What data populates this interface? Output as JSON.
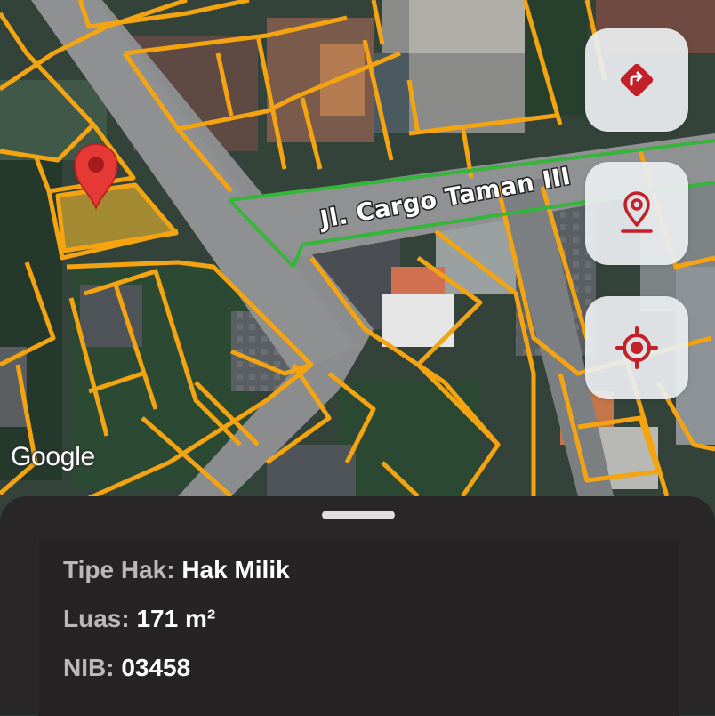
{
  "map": {
    "street_name": "Jl. Cargo Taman III",
    "attribution": "Google",
    "colors": {
      "parcel_outline": "#f4a410",
      "selected_parcel_fill": "#c9a030",
      "street_highlight": "#35b53a",
      "marker": "#e53935"
    }
  },
  "controls": {
    "directions_icon": "directions-icon",
    "pin_icon": "location-pin-icon",
    "locate_icon": "my-location-icon",
    "accent": "#c4202a"
  },
  "info": {
    "tipe_hak_label": "Tipe Hak:",
    "tipe_hak_value": "Hak Milik",
    "luas_label": "Luas:",
    "luas_value": "171 m²",
    "nib_label": "NIB:",
    "nib_value": "03458"
  }
}
